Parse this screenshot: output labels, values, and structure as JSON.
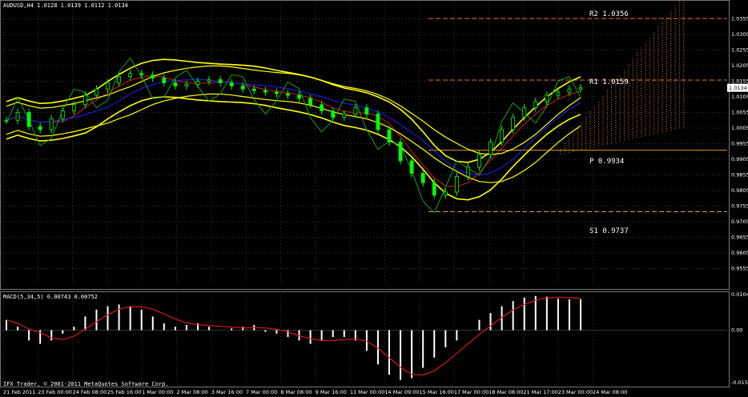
{
  "header": {
    "symbol_line": "AUDUSD,H4  1.0128 1.0139 1.0112 1.0134"
  },
  "macd_header": {
    "label": "MACD(5,34,5) 0.00743 0.00752"
  },
  "footer": {
    "copyright": "IFX Trader, © 2001-2011 MetaQuotes Software Corp."
  },
  "pivot_levels": {
    "r2": {
      "label": "R2 1.0356",
      "value": 1.0356,
      "color": "#e06a3a"
    },
    "r1": {
      "label": "R1 1.0159",
      "value": 1.0159,
      "color": "#e06a3a"
    },
    "p": {
      "label": "P 0.9934",
      "value": 0.9934,
      "color": "#e0a020"
    },
    "s1": {
      "label": "S1 0.9737",
      "value": 0.9737,
      "color": "#c8a070"
    }
  },
  "current_price_label": "1.0134",
  "colors": {
    "background": "#000000",
    "grid": "#3a3a3a",
    "bull_candle": "#00ff00",
    "bollinger": "#ffff00",
    "rsi_like": "#19a019",
    "ma_red": "#d81a1a",
    "ma_blue": "#2020ff",
    "macd_hist": "#ffffff",
    "macd_signal": "#d81a1a",
    "cloud": "#e08030"
  },
  "chart_data": {
    "type": "line",
    "title": "AUDUSD,H4",
    "price_axis": {
      "ylim": [
        0.9505,
        1.0405
      ],
      "ticks": [
        "1.0355",
        "1.0305",
        "1.0255",
        "1.0205",
        "1.0155",
        "1.0105",
        "1.0055",
        "1.0005",
        "0.9955",
        "0.9905",
        "0.9855",
        "0.9805",
        "0.9755",
        "0.9705",
        "0.9655",
        "0.9605",
        "0.9555"
      ]
    },
    "macd_axis": {
      "ylim": [
        -0.0153,
        0.0104
      ],
      "ticks": [
        "0.0104",
        "0.00",
        "-0.0153"
      ]
    },
    "x_ticks": [
      "21 Feb 2011",
      "23 Feb 00:00",
      "24 Feb 08:00",
      "25 Feb 16:00",
      "1 Mar 00:00",
      "2 Mar 08:00",
      "3 Mar 16:00",
      "7 Mar 00:00",
      "8 Mar 08:00",
      "9 Mar 16:00",
      "11 Mar 00:00",
      "14 Mar 09:00",
      "15 Mar 16:00",
      "17 Mar 00:00",
      "18 Mar 08:00",
      "21 Mar 17:00",
      "23 Mar 00:00",
      "24 Mar 08:00"
    ],
    "price_series": {
      "name": "AUDUSD close",
      "values": [
        1.003,
        1.0055,
        1.001,
        1.0,
        1.0035,
        1.006,
        1.008,
        1.011,
        1.013,
        1.015,
        1.017,
        1.018,
        1.0175,
        1.0165,
        1.015,
        1.014,
        1.0145,
        1.0155,
        1.016,
        1.015,
        1.014,
        1.013,
        1.0125,
        1.012,
        1.0115,
        1.011,
        1.01,
        1.008,
        1.006,
        1.004,
        1.005,
        1.007,
        1.005,
        1.0,
        0.996,
        0.99,
        0.986,
        0.983,
        0.979,
        0.98,
        0.985,
        0.988,
        0.992,
        0.996,
        1.0,
        1.004,
        1.007,
        1.009,
        1.011,
        1.012,
        1.013,
        1.0134
      ]
    },
    "macd_hist": [
      0.003,
      0.001,
      -0.003,
      -0.004,
      -0.003,
      -0.001,
      0.001,
      0.004,
      0.006,
      0.007,
      0.0075,
      0.007,
      0.006,
      0.004,
      0.002,
      0.001,
      0.0015,
      0.002,
      0.001,
      0.0,
      0.0005,
      0.001,
      0.0015,
      -0.0005,
      -0.001,
      -0.002,
      -0.003,
      -0.004,
      -0.003,
      -0.002,
      -0.002,
      -0.003,
      -0.006,
      -0.01,
      -0.013,
      -0.0145,
      -0.014,
      -0.011,
      -0.008,
      -0.005,
      -0.003,
      0.0,
      0.003,
      0.005,
      0.007,
      0.0085,
      0.0095,
      0.01,
      0.0098,
      0.0092,
      0.009,
      0.009
    ]
  }
}
